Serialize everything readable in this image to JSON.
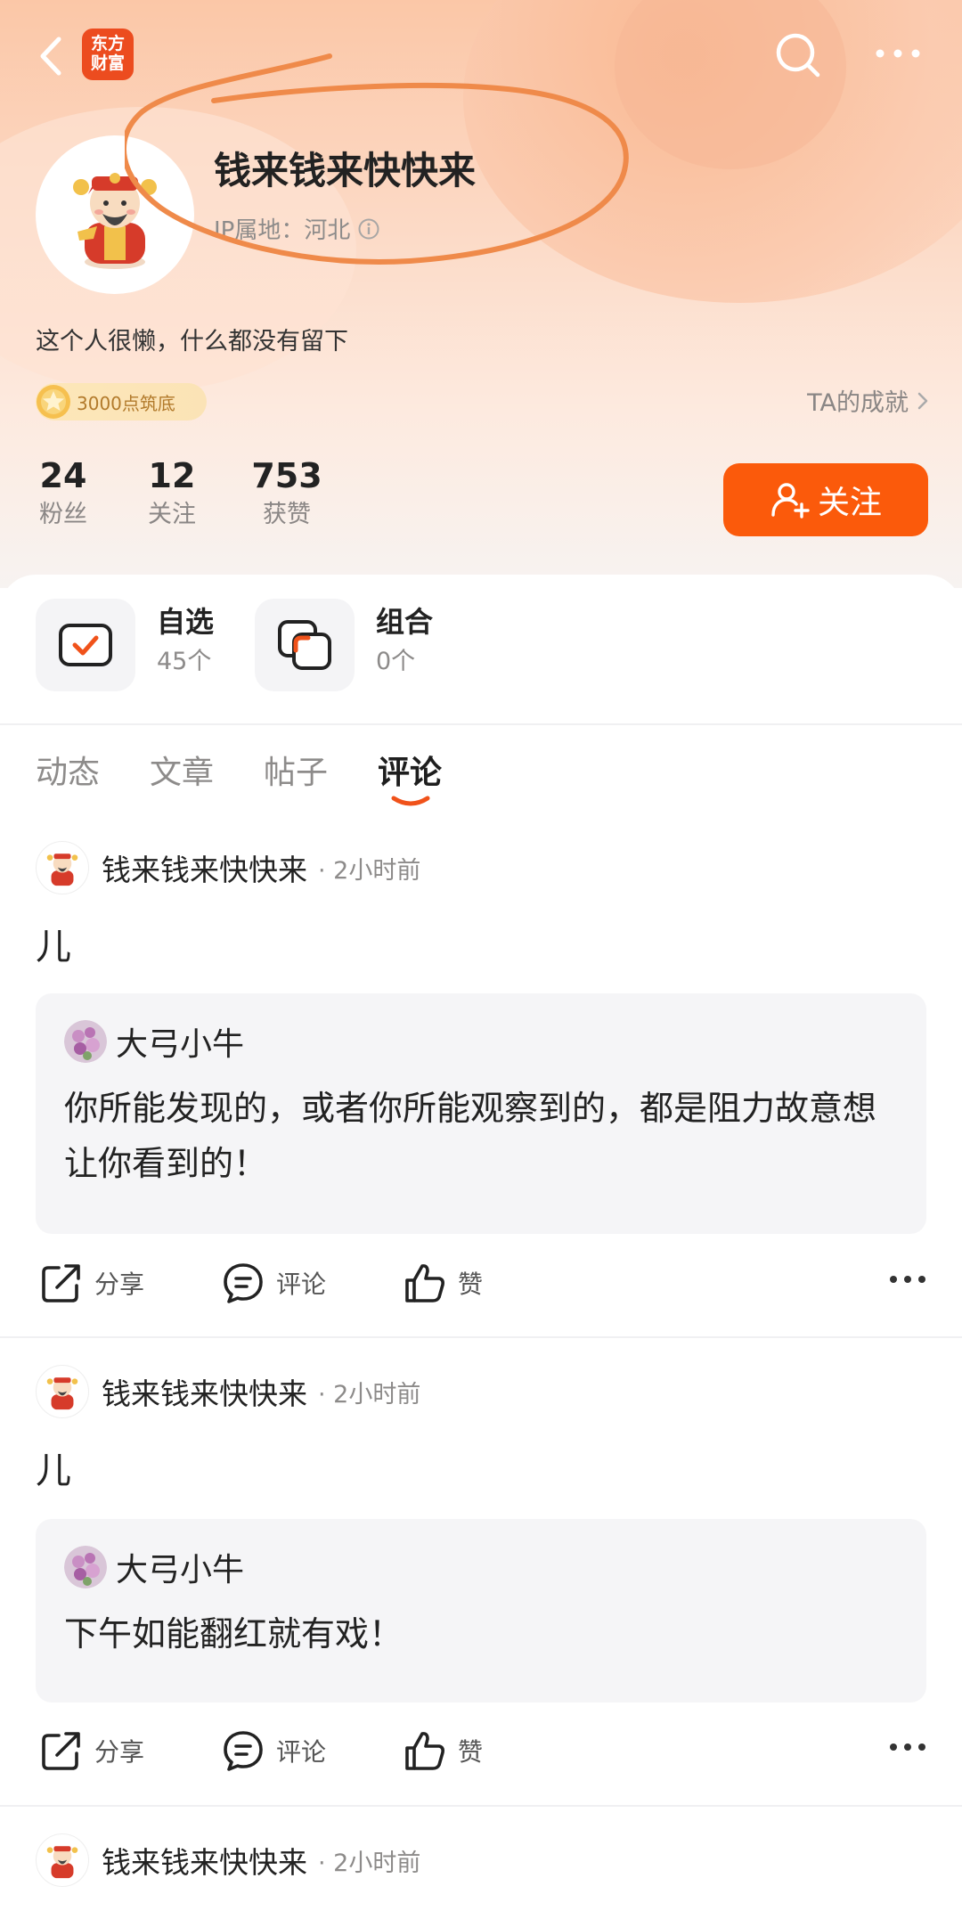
{
  "header": {
    "logo_text_line1": "东方",
    "logo_text_line2": "财富"
  },
  "profile": {
    "name": "钱来钱来快快来",
    "ip_location": "IP属地：河北",
    "bio": "这个人很懒，什么都没有留下",
    "badge": "3000点筑底",
    "achievement_link": "TA的成就",
    "stats": [
      {
        "value": "24",
        "label": "粉丝"
      },
      {
        "value": "12",
        "label": "关注"
      },
      {
        "value": "753",
        "label": "获赞"
      }
    ],
    "follow_label": "关注"
  },
  "tools": [
    {
      "title": "自选",
      "count": "45个"
    },
    {
      "title": "组合",
      "count": "0个"
    }
  ],
  "tabs": [
    "动态",
    "文章",
    "帖子",
    "评论"
  ],
  "active_tab": "评论",
  "posts": [
    {
      "author": "钱来钱来快快来",
      "time": "· 2小时前",
      "text": "儿",
      "quote": {
        "author": "大弓小牛",
        "text": "你所能发现的，或者你所能观察到的，都是阻力故意想让你看到的！"
      },
      "actions": {
        "share": "分享",
        "comment": "评论",
        "like": "赞"
      }
    },
    {
      "author": "钱来钱来快快来",
      "time": "· 2小时前",
      "text": "儿",
      "quote": {
        "author": "大弓小牛",
        "text": "下午如能翻红就有戏！"
      },
      "actions": {
        "share": "分享",
        "comment": "评论",
        "like": "赞"
      }
    },
    {
      "author": "钱来钱来快快来",
      "time": "· 2小时前"
    }
  ],
  "colors": {
    "accent": "#fb5a0b",
    "annotation": "#ef8a4a"
  }
}
